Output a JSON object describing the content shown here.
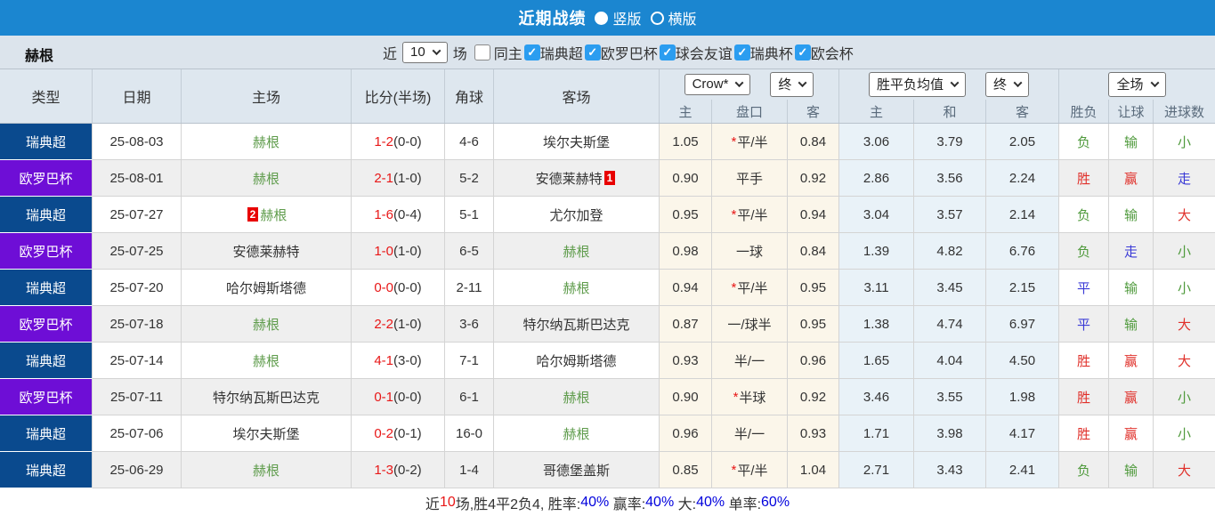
{
  "title_bar": {
    "title": "近期战绩",
    "radio_vertical": "竖版",
    "radio_horizontal": "横版",
    "vertical_selected": true,
    "bar_color": "#1b86d0"
  },
  "filter_bar": {
    "team": "赫根",
    "near_label": "近",
    "near_value": "10",
    "games_label": "场",
    "same_home": {
      "label": "同主",
      "checked": false
    },
    "leagues": [
      {
        "label": "瑞典超",
        "checked": true
      },
      {
        "label": "欧罗巴杯",
        "checked": true
      },
      {
        "label": "球会友谊",
        "checked": true
      },
      {
        "label": "瑞典杯",
        "checked": true
      },
      {
        "label": "欧会杯",
        "checked": true
      }
    ],
    "check_color": "#2b9df0"
  },
  "table": {
    "columns": {
      "type": "类型",
      "date": "日期",
      "home": "主场",
      "score": "比分(半场)",
      "corner": "角球",
      "away": "客场"
    },
    "odds_group": {
      "select_company": "Crow*",
      "select_time": "终",
      "cols": [
        "主",
        "盘口",
        "客"
      ]
    },
    "mean_group": {
      "select_metric": "胜平负均值",
      "select_time": "终",
      "cols": [
        "主",
        "和",
        "客"
      ]
    },
    "full_group": {
      "select_scope": "全场",
      "cols": [
        "胜负",
        "让球",
        "进球数"
      ]
    },
    "league_colors": {
      "瑞典超": "#0a4a8e",
      "欧罗巴杯": "#6e0ed6"
    },
    "rows": [
      {
        "league": "瑞典超",
        "league_color": "navy",
        "date": "25-08-03",
        "home": {
          "name": "赫根",
          "subject": true,
          "badge": ""
        },
        "score": {
          "ft": "1-2",
          "ht": "(0-0)"
        },
        "corner": "4-6",
        "away": {
          "name": "埃尔夫斯堡",
          "subject": false,
          "badge": ""
        },
        "crow": {
          "home": "1.05",
          "star": true,
          "handicap": "平/半",
          "away": "0.84"
        },
        "mean": {
          "home": "3.06",
          "draw": "3.79",
          "away": "2.05"
        },
        "full": {
          "result": {
            "text": "负",
            "color": "green"
          },
          "handicap": {
            "text": "输",
            "color": "green"
          },
          "goals": {
            "text": "小",
            "color": "green"
          }
        }
      },
      {
        "league": "欧罗巴杯",
        "league_color": "purple",
        "date": "25-08-01",
        "home": {
          "name": "赫根",
          "subject": true,
          "badge": ""
        },
        "score": {
          "ft": "2-1",
          "ht": "(1-0)"
        },
        "corner": "5-2",
        "away": {
          "name": "安德莱赫特",
          "subject": false,
          "badge": "1"
        },
        "crow": {
          "home": "0.90",
          "star": false,
          "handicap": "平手",
          "away": "0.92"
        },
        "mean": {
          "home": "2.86",
          "draw": "3.56",
          "away": "2.24"
        },
        "full": {
          "result": {
            "text": "胜",
            "color": "red"
          },
          "handicap": {
            "text": "赢",
            "color": "red"
          },
          "goals": {
            "text": "走",
            "color": "blue"
          }
        }
      },
      {
        "league": "瑞典超",
        "league_color": "navy",
        "date": "25-07-27",
        "home": {
          "name": "赫根",
          "subject": true,
          "badge": "2"
        },
        "score": {
          "ft": "1-6",
          "ht": "(0-4)"
        },
        "corner": "5-1",
        "away": {
          "name": "尤尔加登",
          "subject": false,
          "badge": ""
        },
        "crow": {
          "home": "0.95",
          "star": true,
          "handicap": "平/半",
          "away": "0.94"
        },
        "mean": {
          "home": "3.04",
          "draw": "3.57",
          "away": "2.14"
        },
        "full": {
          "result": {
            "text": "负",
            "color": "green"
          },
          "handicap": {
            "text": "输",
            "color": "green"
          },
          "goals": {
            "text": "大",
            "color": "red"
          }
        }
      },
      {
        "league": "欧罗巴杯",
        "league_color": "purple",
        "date": "25-07-25",
        "home": {
          "name": "安德莱赫特",
          "subject": false,
          "badge": ""
        },
        "score": {
          "ft": "1-0",
          "ht": "(1-0)"
        },
        "corner": "6-5",
        "away": {
          "name": "赫根",
          "subject": true,
          "badge": ""
        },
        "crow": {
          "home": "0.98",
          "star": false,
          "handicap": "一球",
          "away": "0.84"
        },
        "mean": {
          "home": "1.39",
          "draw": "4.82",
          "away": "6.76"
        },
        "full": {
          "result": {
            "text": "负",
            "color": "green"
          },
          "handicap": {
            "text": "走",
            "color": "blue"
          },
          "goals": {
            "text": "小",
            "color": "green"
          }
        }
      },
      {
        "league": "瑞典超",
        "league_color": "navy",
        "date": "25-07-20",
        "home": {
          "name": "哈尔姆斯塔德",
          "subject": false,
          "badge": ""
        },
        "score": {
          "ft": "0-0",
          "ht": "(0-0)"
        },
        "corner": "2-11",
        "away": {
          "name": "赫根",
          "subject": true,
          "badge": ""
        },
        "crow": {
          "home": "0.94",
          "star": true,
          "handicap": "平/半",
          "away": "0.95"
        },
        "mean": {
          "home": "3.11",
          "draw": "3.45",
          "away": "2.15"
        },
        "full": {
          "result": {
            "text": "平",
            "color": "blue"
          },
          "handicap": {
            "text": "输",
            "color": "green"
          },
          "goals": {
            "text": "小",
            "color": "green"
          }
        }
      },
      {
        "league": "欧罗巴杯",
        "league_color": "purple",
        "date": "25-07-18",
        "home": {
          "name": "赫根",
          "subject": true,
          "badge": ""
        },
        "score": {
          "ft": "2-2",
          "ht": "(1-0)"
        },
        "corner": "3-6",
        "away": {
          "name": "特尔纳瓦斯巴达克",
          "subject": false,
          "badge": ""
        },
        "crow": {
          "home": "0.87",
          "star": false,
          "handicap": "一/球半",
          "away": "0.95"
        },
        "mean": {
          "home": "1.38",
          "draw": "4.74",
          "away": "6.97"
        },
        "full": {
          "result": {
            "text": "平",
            "color": "blue"
          },
          "handicap": {
            "text": "输",
            "color": "green"
          },
          "goals": {
            "text": "大",
            "color": "red"
          }
        }
      },
      {
        "league": "瑞典超",
        "league_color": "navy",
        "date": "25-07-14",
        "home": {
          "name": "赫根",
          "subject": true,
          "badge": ""
        },
        "score": {
          "ft": "4-1",
          "ht": "(3-0)"
        },
        "corner": "7-1",
        "away": {
          "name": "哈尔姆斯塔德",
          "subject": false,
          "badge": ""
        },
        "crow": {
          "home": "0.93",
          "star": false,
          "handicap": "半/一",
          "away": "0.96"
        },
        "mean": {
          "home": "1.65",
          "draw": "4.04",
          "away": "4.50"
        },
        "full": {
          "result": {
            "text": "胜",
            "color": "red"
          },
          "handicap": {
            "text": "赢",
            "color": "red"
          },
          "goals": {
            "text": "大",
            "color": "red"
          }
        }
      },
      {
        "league": "欧罗巴杯",
        "league_color": "purple",
        "date": "25-07-11",
        "home": {
          "name": "特尔纳瓦斯巴达克",
          "subject": false,
          "badge": ""
        },
        "score": {
          "ft": "0-1",
          "ht": "(0-0)"
        },
        "corner": "6-1",
        "away": {
          "name": "赫根",
          "subject": true,
          "badge": ""
        },
        "crow": {
          "home": "0.90",
          "star": true,
          "handicap": "半球",
          "away": "0.92"
        },
        "mean": {
          "home": "3.46",
          "draw": "3.55",
          "away": "1.98"
        },
        "full": {
          "result": {
            "text": "胜",
            "color": "red"
          },
          "handicap": {
            "text": "赢",
            "color": "red"
          },
          "goals": {
            "text": "小",
            "color": "green"
          }
        }
      },
      {
        "league": "瑞典超",
        "league_color": "navy",
        "date": "25-07-06",
        "home": {
          "name": "埃尔夫斯堡",
          "subject": false,
          "badge": ""
        },
        "score": {
          "ft": "0-2",
          "ht": "(0-1)"
        },
        "corner": "16-0",
        "away": {
          "name": "赫根",
          "subject": true,
          "badge": ""
        },
        "crow": {
          "home": "0.96",
          "star": false,
          "handicap": "半/一",
          "away": "0.93"
        },
        "mean": {
          "home": "1.71",
          "draw": "3.98",
          "away": "4.17"
        },
        "full": {
          "result": {
            "text": "胜",
            "color": "red"
          },
          "handicap": {
            "text": "赢",
            "color": "red"
          },
          "goals": {
            "text": "小",
            "color": "green"
          }
        }
      },
      {
        "league": "瑞典超",
        "league_color": "navy",
        "date": "25-06-29",
        "home": {
          "name": "赫根",
          "subject": true,
          "badge": ""
        },
        "score": {
          "ft": "1-3",
          "ht": "(0-2)"
        },
        "corner": "1-4",
        "away": {
          "name": "哥德堡盖斯",
          "subject": false,
          "badge": ""
        },
        "crow": {
          "home": "0.85",
          "star": true,
          "handicap": "平/半",
          "away": "1.04"
        },
        "mean": {
          "home": "2.71",
          "draw": "3.43",
          "away": "2.41"
        },
        "full": {
          "result": {
            "text": "负",
            "color": "green"
          },
          "handicap": {
            "text": "输",
            "color": "green"
          },
          "goals": {
            "text": "大",
            "color": "red"
          }
        }
      }
    ]
  },
  "footer": {
    "near": "近",
    "count": "10",
    "seg1": "场,胜4平2负4, 胜率:",
    "win_rate": "40%",
    "seg2": " 赢率:",
    "profit_rate": "40%",
    "seg3": " 大:",
    "big_rate": "40%",
    "seg4": " 单率:",
    "single_rate": "60%"
  }
}
